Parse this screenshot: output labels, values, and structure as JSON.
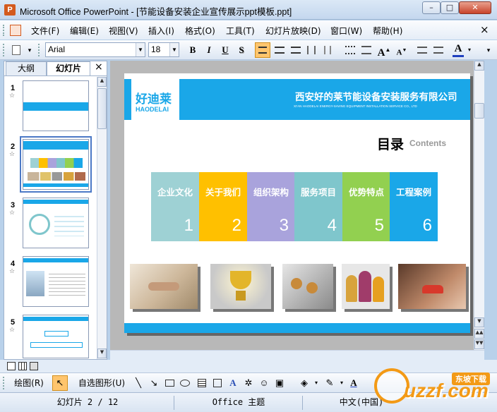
{
  "window": {
    "title": "Microsoft Office PowerPoint - [节能设备安装企业宣传展示ppt模板.ppt]",
    "app_icon": "powerpoint-icon",
    "minimize": "–",
    "restore": "□",
    "close": "✕",
    "doc_close": "×"
  },
  "menu": {
    "items": [
      "文件(F)",
      "编辑(E)",
      "视图(V)",
      "插入(I)",
      "格式(O)",
      "工具(T)",
      "幻灯片放映(D)",
      "窗口(W)",
      "帮助(H)"
    ]
  },
  "toolbar": {
    "font": "Arial",
    "size": "18",
    "bold": "B",
    "italic": "I",
    "underline": "U",
    "shadow": "S",
    "align_left_active": true,
    "grow": "A",
    "shrink": "A",
    "font_color": "A",
    "font_color_value": "#1f3fbf"
  },
  "left_panel": {
    "tabs": [
      "大纲",
      "幻灯片"
    ],
    "active_tab": "幻灯片",
    "close": "×",
    "slides": [
      "1",
      "2",
      "3",
      "4",
      "5"
    ],
    "star": "☆",
    "selected": "2"
  },
  "slide": {
    "logo_text": "好迪莱",
    "logo_sub": "HAODELAI",
    "company": "西安好的莱节能设备安装服务有限公司",
    "company_sub": "XI'AN HAODELAI ENERGY-SAVING EQUIPMENT INSTALLATION SERVICE CO., LTD",
    "toc_cn": "目录",
    "toc_en": "Contents",
    "accent": "#1aa7e8",
    "cells": [
      {
        "label": "企业文化",
        "num": "1",
        "color": "#9ed1d4"
      },
      {
        "label": "关于我们",
        "num": "2",
        "color": "#ffc000"
      },
      {
        "label": "组织架构",
        "num": "3",
        "color": "#a9a3dc"
      },
      {
        "label": "服务项目",
        "num": "4",
        "color": "#7fc6cc"
      },
      {
        "label": "优势特点",
        "num": "5",
        "color": "#92d050"
      },
      {
        "label": "工程案例",
        "num": "6",
        "color": "#1aa7e8"
      }
    ],
    "photos": [
      "hands-photo",
      "trophy-photo",
      "plug-photo",
      "people-icons-photo",
      "car-hands-photo"
    ]
  },
  "drawbar": {
    "draw": "绘图(R)",
    "autoshape": "自选图形(U)"
  },
  "status": {
    "slide": "幻灯片 2 / 12",
    "theme": "Office 主题",
    "lang": "中文(中国)"
  },
  "watermark": {
    "text": "uzzf.com",
    "badge": "东坡下载"
  }
}
